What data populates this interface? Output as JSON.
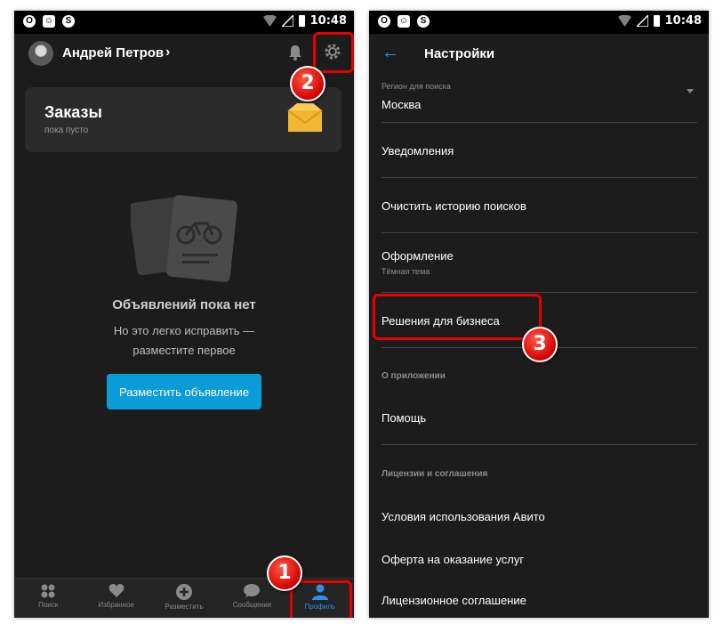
{
  "status_bar": {
    "time": "10:48"
  },
  "profile": {
    "user_name": "Андрей Петров",
    "orders": {
      "title": "Заказы",
      "subtitle": "пока пусто"
    },
    "empty_state": {
      "title": "Объявлений пока нет",
      "line1": "Но это легко исправить —",
      "line2": "разместите первое"
    },
    "post_button_label": "Разместить объявление",
    "bottom_nav": [
      {
        "label": "Поиск",
        "icon": "search-dots-icon"
      },
      {
        "label": "Избранное",
        "icon": "heart-icon"
      },
      {
        "label": "Разместить",
        "icon": "plus-circle-icon"
      },
      {
        "label": "Сообщения",
        "icon": "chat-bubble-icon"
      },
      {
        "label": "Профиль",
        "icon": "user-icon",
        "active": true
      }
    ]
  },
  "settings": {
    "title": "Настройки",
    "region": {
      "label": "Регион для поиска",
      "value": "Москва"
    },
    "items": {
      "notifications": "Уведомления",
      "clear_history": "Очистить историю поисков",
      "appearance": "Оформление",
      "appearance_value": "Тёмная тема",
      "business": "Решения для бизнеса",
      "help": "Помощь",
      "terms": "Условия использования Авито",
      "offer": "Оферта на оказание услуг",
      "license": "Лицензионное соглашение"
    },
    "sections": {
      "about": "О приложении",
      "licenses": "Лицензии и соглашения"
    }
  },
  "annotations": {
    "badge1": "1",
    "badge2": "2",
    "badge3": "3"
  },
  "colors": {
    "accent_blue": "#0b9bd8",
    "highlight_red": "#e60000",
    "background": "#1c1c1c"
  }
}
